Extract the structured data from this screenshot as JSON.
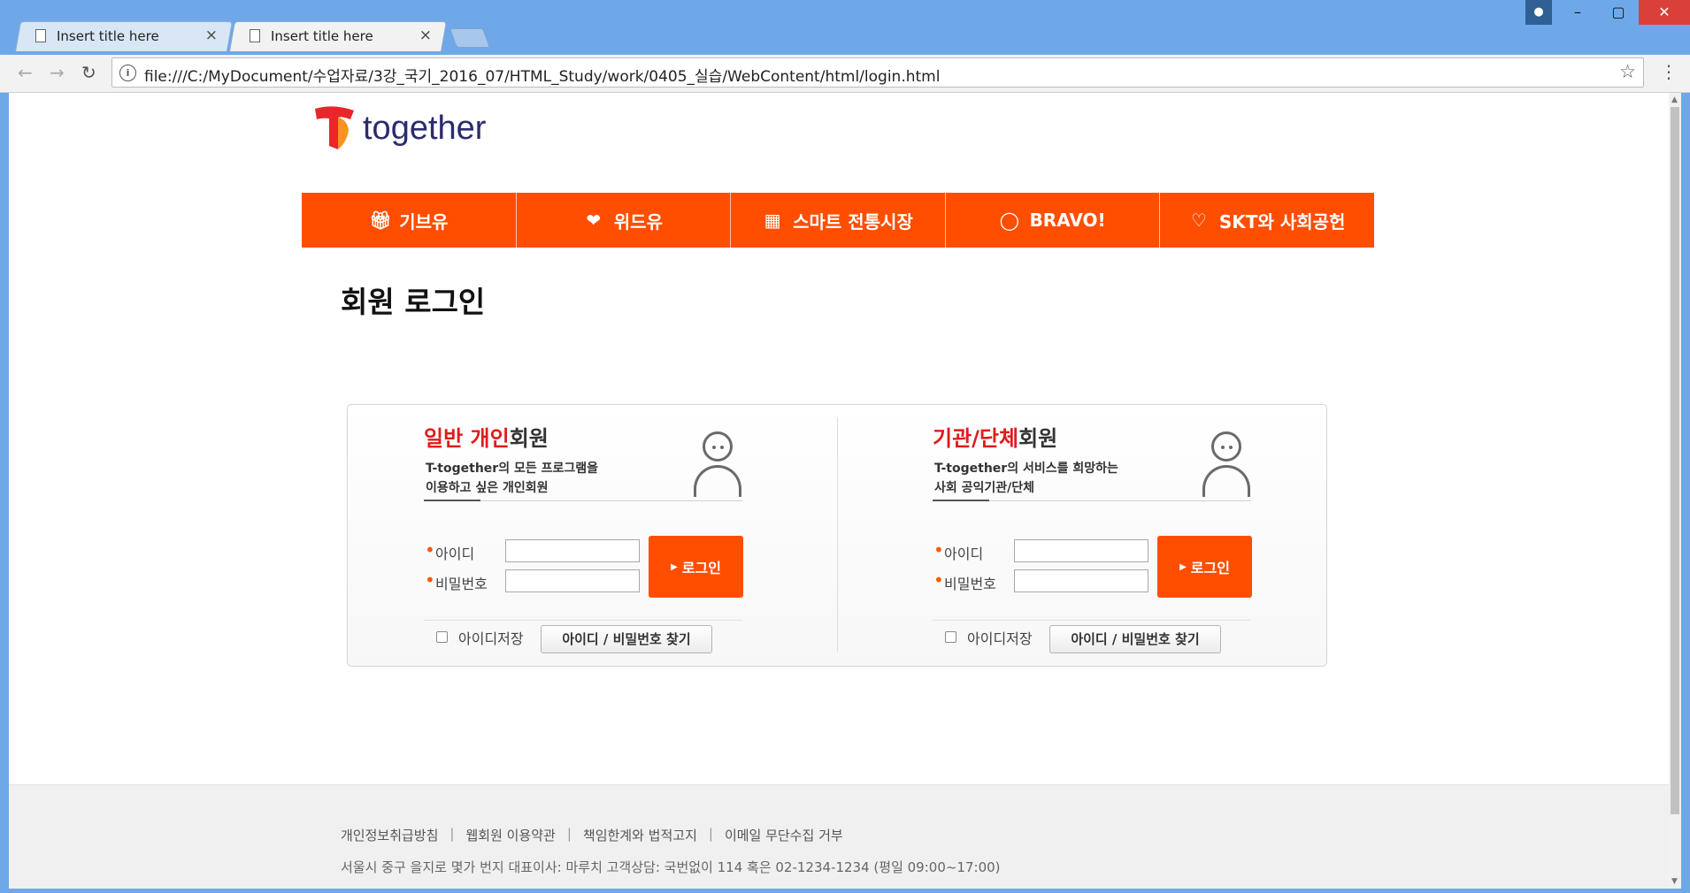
{
  "browser": {
    "tabs": [
      {
        "title": "Insert title here",
        "active": false
      },
      {
        "title": "Insert title here",
        "active": true
      }
    ],
    "close_symbol": "×",
    "url": "file:///C:/MyDocument/수업자료/3강_국기_2016_07/HTML_Study/work/0405_실습/WebContent/html/login.html",
    "icons": {
      "back": "back-arrow-icon",
      "forward": "forward-arrow-icon",
      "reload": "reload-icon",
      "info": "info-icon",
      "bookmark": "star-icon",
      "menu": "menu-dots-icon"
    }
  },
  "site": {
    "logo_text": "together",
    "brand_color": "#ff4e00",
    "nav": [
      {
        "label": "기브유",
        "icon": "gift-icon"
      },
      {
        "label": "위드유",
        "icon": "heart-hands-icon"
      },
      {
        "label": "스마트 전통시장",
        "icon": "basket-icon"
      },
      {
        "label": "BRAVO!",
        "icon": "bottle-icon"
      },
      {
        "label": "SKT와 사회공헌",
        "icon": "trophy-icon"
      }
    ]
  },
  "page": {
    "title": "회원 로그인",
    "panels": [
      {
        "title_highlight": "일반 개인",
        "title_rest": "회원",
        "desc": "T-together의 모든 프로그램을\n이용하고 싶은 개인회원",
        "id_label": "아이디",
        "pw_label": "비밀번호",
        "login_label": "로그인",
        "save_id_label": "아이디저장",
        "find_label": "아이디 / 비밀번호 찾기"
      },
      {
        "title_highlight": "기관/단체",
        "title_rest": "회원",
        "desc": "T-together의 서비스를 희망하는\n사회 공익기관/단체",
        "id_label": "아이디",
        "pw_label": "비밀번호",
        "login_label": "로그인",
        "save_id_label": "아이디저장",
        "find_label": "아이디 / 비밀번호 찾기"
      }
    ]
  },
  "footer": {
    "links": [
      "개인정보취급방침",
      "웹회원 이용약관",
      "책임한계와 법적고지",
      "이메일 무단수집 거부"
    ],
    "address": "서울시 중구 을지로 몇가 번지 대표이사: 마루치 고객상담: 국번없이 114 혹은 02-1234-1234 (평일 09:00~17:00)"
  }
}
